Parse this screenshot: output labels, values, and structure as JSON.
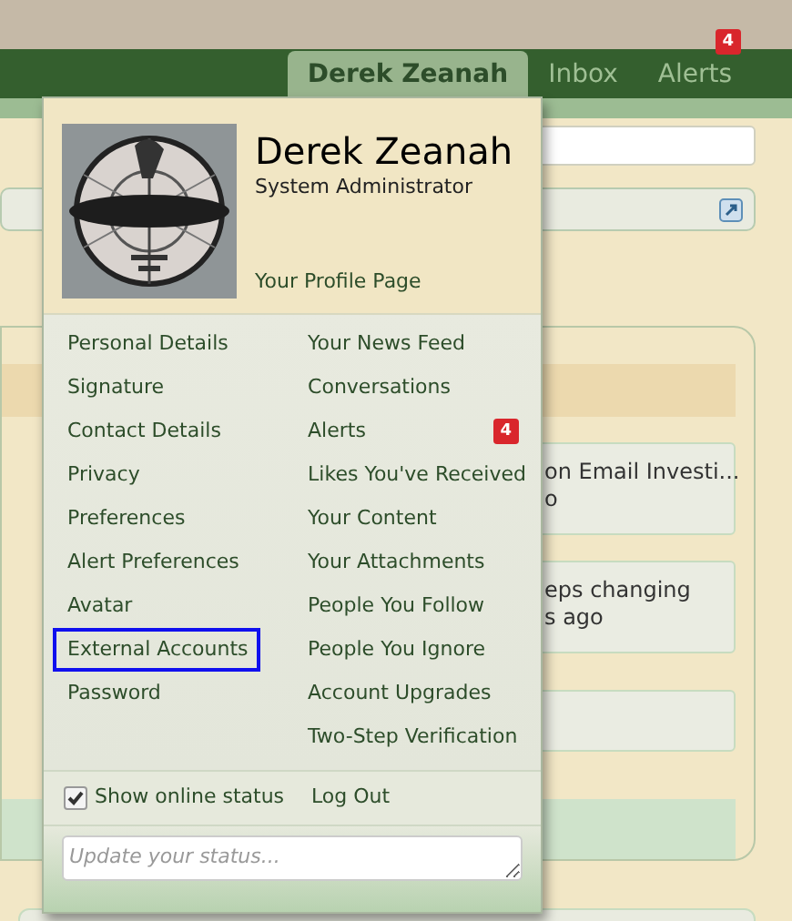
{
  "nav": {
    "tabs": [
      {
        "label": "Derek Zeanah",
        "selected": true
      },
      {
        "label": "Inbox",
        "selected": false
      },
      {
        "label": "Alerts",
        "selected": false,
        "badge": "4"
      }
    ]
  },
  "background": {
    "items": [
      {
        "title": "on Email Investi...",
        "meta": "o"
      },
      {
        "title": "eps changing",
        "meta": "s ago"
      }
    ]
  },
  "menu": {
    "name": "Derek Zeanah",
    "role": "System Administrator",
    "profile_link": "Your Profile Page",
    "left": [
      {
        "label": "Personal Details",
        "selected": false
      },
      {
        "label": "Signature",
        "selected": false
      },
      {
        "label": "Contact Details",
        "selected": false
      },
      {
        "label": "Privacy",
        "selected": false
      },
      {
        "label": "Preferences",
        "selected": false
      },
      {
        "label": "Alert Preferences",
        "selected": false
      },
      {
        "label": "Avatar",
        "selected": false
      },
      {
        "label": "External Accounts",
        "selected": true
      },
      {
        "label": "Password",
        "selected": false
      }
    ],
    "right": [
      {
        "label": "Your News Feed"
      },
      {
        "label": "Conversations"
      },
      {
        "label": "Alerts",
        "badge": "4"
      },
      {
        "label": "Likes You've Received"
      },
      {
        "label": "Your Content"
      },
      {
        "label": "Your Attachments"
      },
      {
        "label": "People You Follow"
      },
      {
        "label": "People You Ignore"
      },
      {
        "label": "Account Upgrades"
      },
      {
        "label": "Two-Step Verification"
      }
    ],
    "online_status": {
      "label": "Show online status",
      "checked": true
    },
    "logout": "Log Out",
    "status": {
      "placeholder": "Update your status..."
    }
  }
}
